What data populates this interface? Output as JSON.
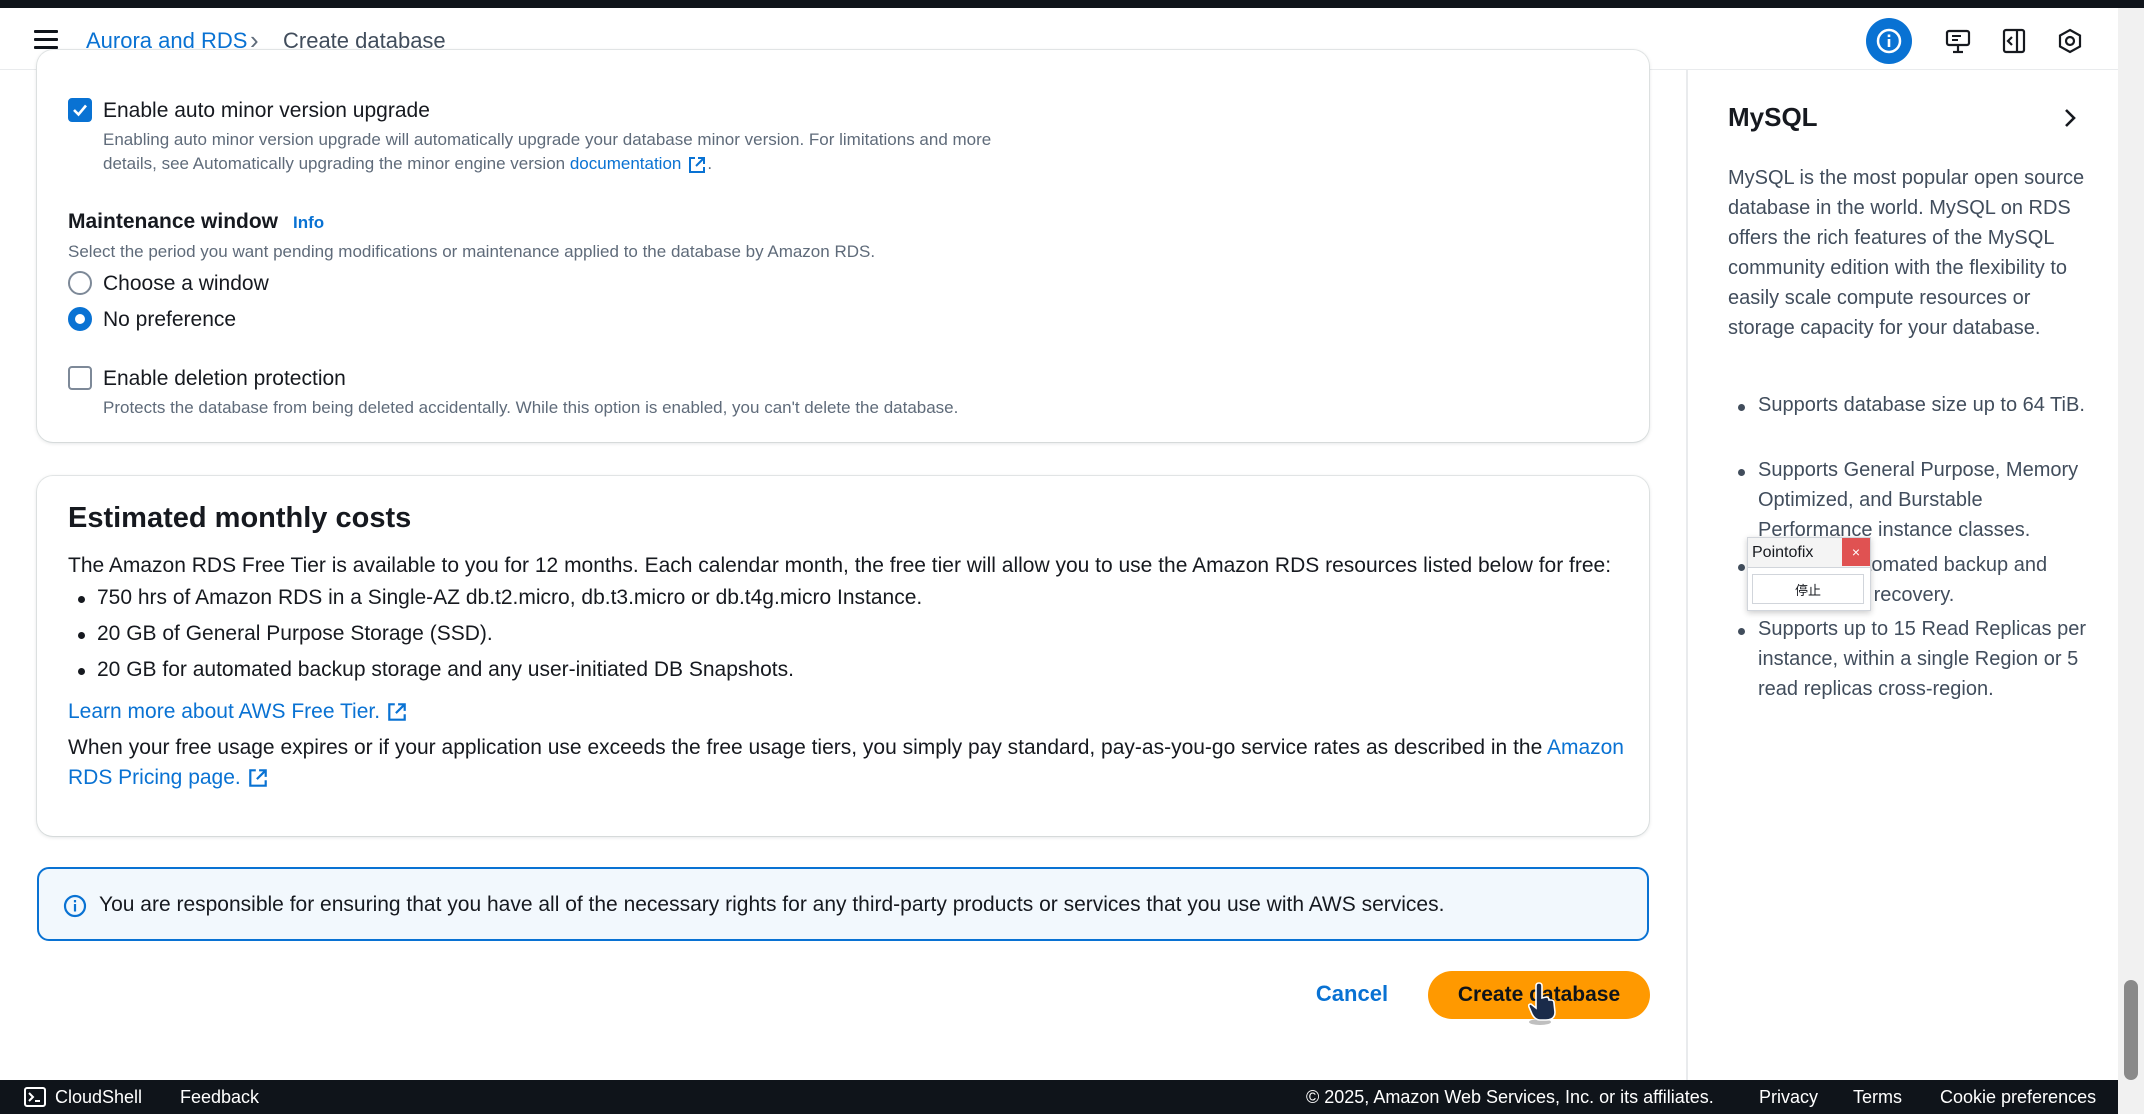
{
  "header": {
    "breadcrumb": {
      "parent": "Aurora and RDS",
      "current": "Create database"
    }
  },
  "form": {
    "auto_minor": {
      "checkbox_label": "Enable auto minor version upgrade",
      "checked": true,
      "description_line1": "Enabling auto minor version upgrade will automatically upgrade your database minor version. For limitations and more",
      "description_line2_prefix": "details, see Automatically upgrading the minor engine version",
      "doc_link": "documentation",
      "description_line2_suffix": "."
    },
    "maintenance": {
      "title": "Maintenance window",
      "info": "Info",
      "description": "Select the period you want pending modifications or maintenance applied to the database by Amazon RDS.",
      "options": [
        "Choose a window",
        "No preference"
      ],
      "selected": "No preference"
    },
    "deletion_protection": {
      "label": "Enable deletion protection",
      "checked": false,
      "description": "Protects the database from being deleted accidentally. While this option is enabled, you can't delete the database."
    }
  },
  "costs": {
    "title": "Estimated monthly costs",
    "intro": "The Amazon RDS Free Tier is available to you for 12 months. Each calendar month, the free tier will allow you to use the Amazon RDS resources listed below for free:",
    "items": [
      "750 hrs of Amazon RDS in a Single-AZ db.t2.micro, db.t3.micro or db.t4g.micro Instance.",
      "20 GB of General Purpose Storage (SSD).",
      "20 GB for automated backup storage and any user-initiated DB Snapshots."
    ],
    "learn_more": "Learn more about AWS Free Tier.",
    "expire_text": "When your free usage expires or if your application use exceeds the free usage tiers, you simply pay standard, pay-as-you-go service rates as described in the",
    "pricing_link_part1": "Amazon",
    "pricing_link_part2": "RDS Pricing page."
  },
  "alert": {
    "text": "You are responsible for ensuring that you have all of the necessary rights for any third-party products or services that you use with AWS services."
  },
  "actions": {
    "cancel": "Cancel",
    "create": "Create database"
  },
  "help_panel": {
    "title": "MySQL",
    "intro": "MySQL is the most popular open source database in the world. MySQL on RDS offers the rich features of the MySQL community edition with the flexibility to easily scale compute resources or storage capacity for your database.",
    "bullets": [
      "Supports database size up to 64 TiB.",
      "Supports General Purpose, Memory Optimized, and Burstable Performance instance classes.",
      "Supports automated backup and point-in-time recovery.",
      "Supports up to 15 Read Replicas per instance, within a single Region or 5 read replicas cross-region."
    ]
  },
  "overlay": {
    "title": "Pointofix",
    "close": "×",
    "body": "停止"
  },
  "footer": {
    "cloudshell": "CloudShell",
    "feedback": "Feedback",
    "copyright": "© 2025, Amazon Web Services, Inc. or its affiliates.",
    "privacy": "Privacy",
    "terms": "Terms",
    "cookies": "Cookie preferences"
  },
  "colors": {
    "accent": "#0972d3",
    "primary_button": "#ff9900",
    "footer_bg": "#0f141a"
  }
}
